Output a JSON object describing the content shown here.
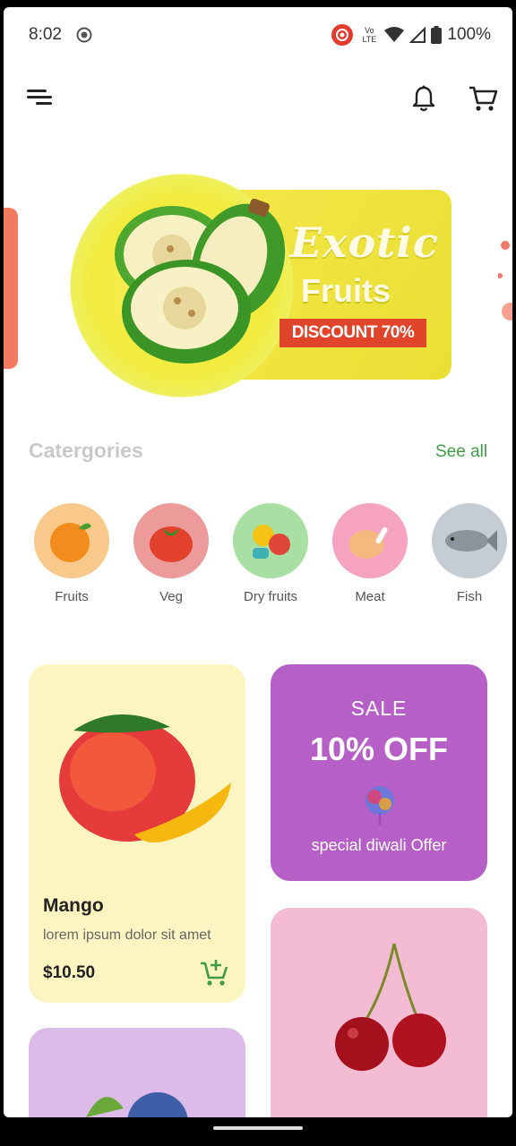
{
  "status_bar": {
    "time": "8:02",
    "network_label": "Vo LTE",
    "battery": "100%"
  },
  "app_bar": {
    "menu_icon": "menu-icon",
    "bell_icon": "bell-icon",
    "cart_icon": "cart-icon"
  },
  "banner": {
    "title_line1": "Exotic",
    "title_line2": "Fruits",
    "discount": "DISCOUNT 70%"
  },
  "categories": {
    "title": "Catergories",
    "see_all": "See all",
    "items": [
      {
        "label": "Fruits",
        "color": "#f8c98a"
      },
      {
        "label": "Veg",
        "color": "#ec9a9a"
      },
      {
        "label": "Dry fruits",
        "color": "#a8dfa3"
      },
      {
        "label": "Meat",
        "color": "#f5a3c0"
      },
      {
        "label": "Fish",
        "color": "#c5ccd3"
      }
    ]
  },
  "products": [
    {
      "name": "Mango",
      "description": "lorem ipsum dolor sit amet",
      "price": "$10.50",
      "bg": "#fcf5c2"
    }
  ],
  "promo": {
    "line1": "SALE",
    "line2": "10% OFF",
    "line3": "special diwali Offer",
    "bg": "#b65fc6"
  },
  "colors": {
    "accent_green": "#3e9c45",
    "cherry_card": "#f4bcd2",
    "blueberry_card": "#dcbbe9"
  }
}
